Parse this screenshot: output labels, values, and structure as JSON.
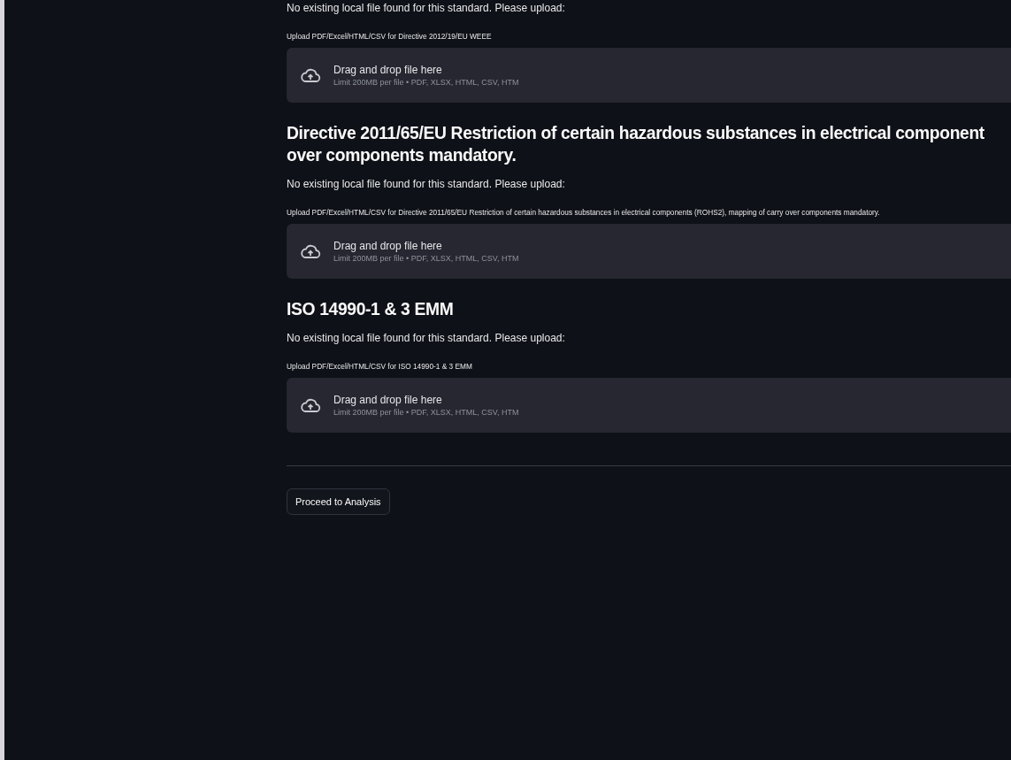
{
  "sections": [
    {
      "notice": "No existing local file found for this standard. Please upload:",
      "upload_label": "Upload PDF/Excel/HTML/CSV for Directive 2012/19/EU WEEE",
      "dropzone": {
        "title": "Drag and drop file here",
        "limit": "Limit 200MB per file • PDF, XLSX, HTML, CSV, HTM"
      }
    },
    {
      "heading_lines": [
        "Directive 2011/65/EU Restriction of certain hazardous substances in electrical component",
        "over components mandatory."
      ],
      "notice": "No existing local file found for this standard. Please upload:",
      "upload_label": "Upload PDF/Excel/HTML/CSV for Directive 2011/65/EU Restriction of certain hazardous substances in electrical components (ROHS2), mapping of carry over components mandatory.",
      "dropzone": {
        "title": "Drag and drop file here",
        "limit": "Limit 200MB per file • PDF, XLSX, HTML, CSV, HTM"
      }
    },
    {
      "heading_lines": [
        "ISO 14990-1 & 3 EMM"
      ],
      "notice": "No existing local file found for this standard. Please upload:",
      "upload_label": "Upload PDF/Excel/HTML/CSV for ISO 14990-1 & 3 EMM",
      "dropzone": {
        "title": "Drag and drop file here",
        "limit": "Limit 200MB per file • PDF, XLSX, HTML, CSV, HTM"
      }
    }
  ],
  "proceed_button": "Proceed to Analysis"
}
